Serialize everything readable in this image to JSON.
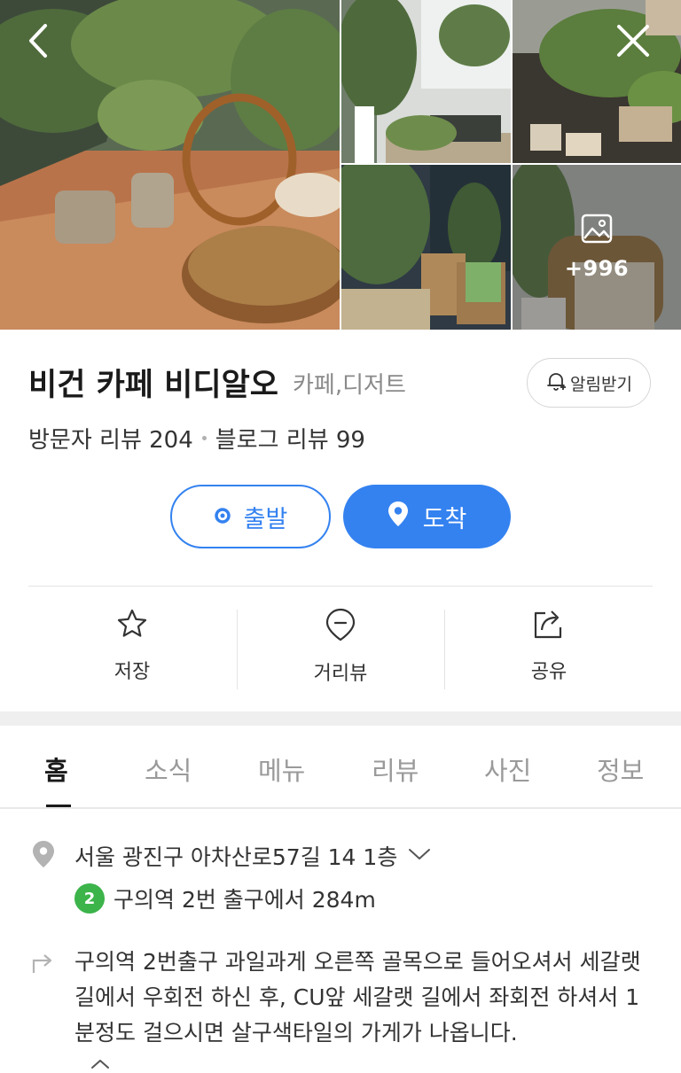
{
  "gallery": {
    "more_count": "+996",
    "photos": [
      "main-terrace-photo",
      "window-plants-photo",
      "counter-plants-photo",
      "seating-plants-photo",
      "armchair-photo"
    ]
  },
  "header": {
    "back_icon": "chevron-left-icon",
    "close_icon": "close-icon"
  },
  "place": {
    "name": "비건 카페 비디알오",
    "category": "카페,디저트",
    "notify_label": "알림받기",
    "visitor_reviews": "방문자 리뷰 204",
    "blog_reviews": "블로그 리뷰 99"
  },
  "route": {
    "depart_label": "출발",
    "arrive_label": "도착"
  },
  "actions": [
    {
      "label": "저장",
      "icon": "star-icon"
    },
    {
      "label": "거리뷰",
      "icon": "street-view-icon"
    },
    {
      "label": "공유",
      "icon": "share-icon"
    }
  ],
  "tabs": [
    "홈",
    "소식",
    "메뉴",
    "리뷰",
    "사진",
    "정보"
  ],
  "active_tab": "홈",
  "info": {
    "address": "서울 광진구 아차산로57길 14 1층",
    "subway_line": "2",
    "subway_text": "구의역 2번 출구에서 284m",
    "directions": "구의역 2번출구 과일과게 오른쪽 골목으로 들어오셔서 세갈랫 길에서 우회전 하신 후, CU앞 세갈랫 길에서 좌회전 하셔서 1분정도 걸으시면 살구색타일의 가게가 나옵니다."
  },
  "colors": {
    "accent": "#3482f0",
    "line2": "#3cb44a"
  }
}
